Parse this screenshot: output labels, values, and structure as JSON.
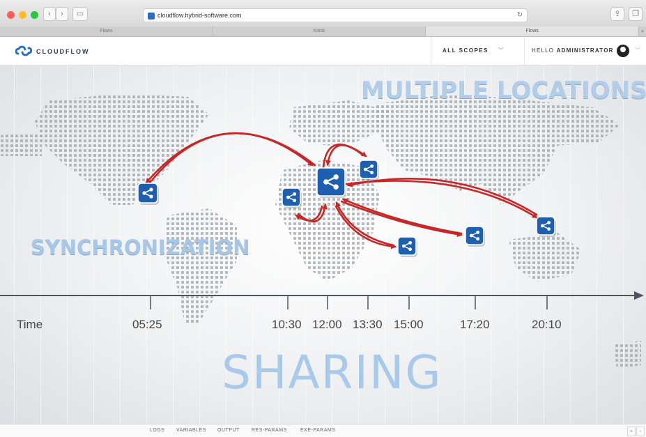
{
  "browser": {
    "url": "cloudflow.hybrid-software.com",
    "tabs": [
      "Flows",
      "Kiosk",
      "Flows"
    ],
    "new_tab_label": "+"
  },
  "app": {
    "brand": "CLOUDFLOW",
    "scopes_label": "ALL SCOPES",
    "hello_prefix": "HELLO",
    "user_name": "ADMINISTRATOR"
  },
  "graphic": {
    "headline_top": "MULTIPLE LOCATIONS",
    "headline_left": "SYNCHRONIZATION",
    "headline_bottom": "SHARING",
    "time_label": "Time",
    "times": [
      "05:25",
      "10:30",
      "12:00",
      "13:30",
      "15:00",
      "17:20",
      "20:10"
    ],
    "arrow_color": "#c62828",
    "node_color": "#1f5fb0",
    "hub_time": "12:00"
  },
  "bottom_tabs": [
    "LOGS",
    "VARIABLES",
    "OUTPUT",
    "RES-PARAMS",
    "EXE-PARAMS"
  ],
  "bottom_buttons": [
    "+",
    "-"
  ]
}
